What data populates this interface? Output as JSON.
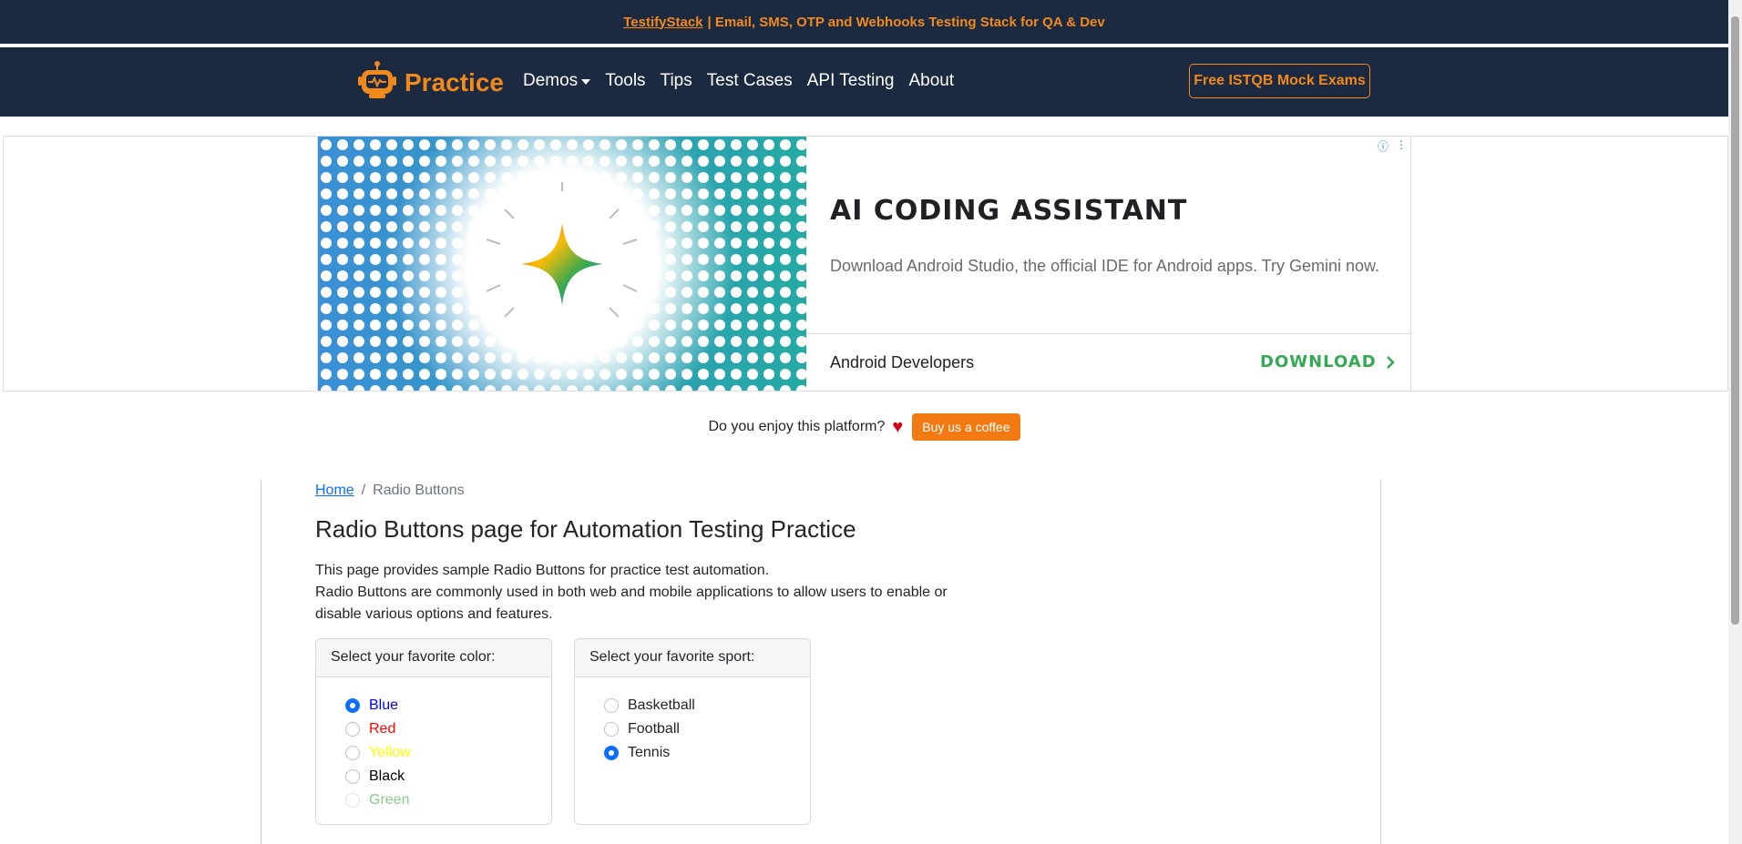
{
  "topbar": {
    "link": "TestifyStack",
    "text": "| Email, SMS, OTP and Webhooks Testing Stack for QA & Dev"
  },
  "nav": {
    "brand": "Practice",
    "links": [
      "Demos",
      "Tools",
      "Tips",
      "Test Cases",
      "API Testing",
      "About"
    ],
    "cta": "Free ISTQB Mock Exams"
  },
  "ad": {
    "title": "AI CODING ASSISTANT",
    "description": "Download Android Studio, the official IDE for Android apps. Try Gemini now.",
    "advertiser": "Android Developers",
    "cta": "DOWNLOAD",
    "info_icon": "ⓘ",
    "menu_icon": "⋮"
  },
  "coffee": {
    "question": "Do you enjoy this platform?",
    "button": "Buy us a coffee"
  },
  "breadcrumb": {
    "home": "Home",
    "separator": "/",
    "current": "Radio Buttons"
  },
  "page": {
    "title": "Radio Buttons page for Automation Testing Practice",
    "intro_line1": "This page provides sample Radio Buttons for practice test automation.",
    "intro_line2": "Radio Buttons are commonly used in both web and mobile applications to allow users to enable or disable various options and features."
  },
  "color_group": {
    "header": "Select your favorite color:",
    "options": [
      {
        "label": "Blue",
        "color": "#0000ff",
        "checked": true,
        "disabled": false
      },
      {
        "label": "Red",
        "color": "#ff0000",
        "checked": false,
        "disabled": false
      },
      {
        "label": "Yellow",
        "color": "#ffff00",
        "checked": false,
        "disabled": false
      },
      {
        "label": "Black",
        "color": "#000000",
        "checked": false,
        "disabled": false
      },
      {
        "label": "Green",
        "color": "#8ccb8c",
        "checked": false,
        "disabled": true
      }
    ]
  },
  "sport_group": {
    "header": "Select your favorite sport:",
    "options": [
      {
        "label": "Basketball",
        "checked": false
      },
      {
        "label": "Football",
        "checked": false
      },
      {
        "label": "Tennis",
        "checked": true
      }
    ]
  },
  "colors": {
    "navy": "#1b2a41",
    "accent": "#f28a1b",
    "link": "#0d6efd",
    "ad_cta": "#34a853"
  }
}
